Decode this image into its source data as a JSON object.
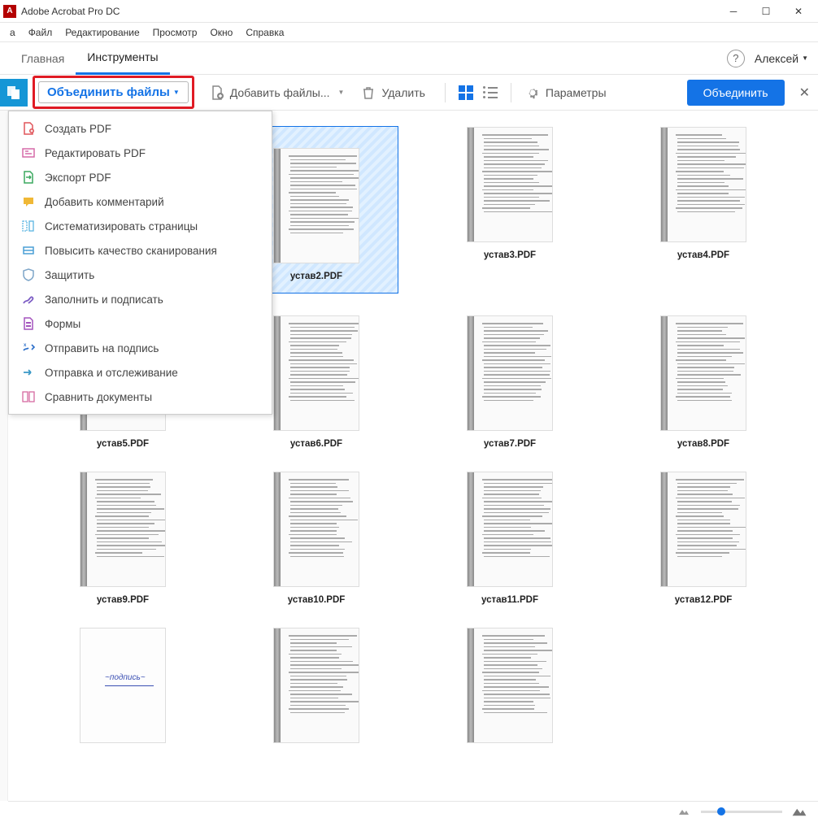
{
  "titlebar": {
    "title": "Adobe Acrobat Pro DC"
  },
  "menubar": {
    "items": [
      "а",
      "Файл",
      "Редактирование",
      "Просмотр",
      "Окно",
      "Справка"
    ]
  },
  "tabs": {
    "items": [
      "Главная",
      "Инструменты"
    ],
    "active_index": 1,
    "user": "Алексей"
  },
  "toolbar": {
    "combine_label": "Объединить файлы",
    "add_label": "Добавить файлы...",
    "delete_label": "Удалить",
    "params_label": "Параметры",
    "action_label": "Объединить"
  },
  "dropdown": {
    "items": [
      {
        "label": "Создать PDF",
        "icon": "create-pdf",
        "color": "#e0555a"
      },
      {
        "label": "Редактировать PDF",
        "icon": "edit-pdf",
        "color": "#d66aa8"
      },
      {
        "label": "Экспорт PDF",
        "icon": "export-pdf",
        "color": "#3aa85f"
      },
      {
        "label": "Добавить комментарий",
        "icon": "comment",
        "color": "#f0b836"
      },
      {
        "label": "Систематизировать страницы",
        "icon": "organize",
        "color": "#5ab5e2"
      },
      {
        "label": "Повысить качество сканирования",
        "icon": "enhance-scan",
        "color": "#4a9fd6"
      },
      {
        "label": "Защитить",
        "icon": "shield",
        "color": "#7fa6c9"
      },
      {
        "label": "Заполнить и подписать",
        "icon": "fill-sign",
        "color": "#7c5cc4"
      },
      {
        "label": "Формы",
        "icon": "forms",
        "color": "#a454bd"
      },
      {
        "label": "Отправить на подпись",
        "icon": "send-sign",
        "color": "#2b6ec9"
      },
      {
        "label": "Отправка и отслеживание",
        "icon": "send-track",
        "color": "#3998c6"
      },
      {
        "label": "Сравнить документы",
        "icon": "compare",
        "color": "#d66aa0"
      }
    ]
  },
  "files": [
    {
      "name": "устав2.PDF",
      "selected": true
    },
    {
      "name": "устав3.PDF",
      "selected": false
    },
    {
      "name": "устав4.PDF",
      "selected": false
    },
    {
      "name": "устав5.PDF",
      "selected": false
    },
    {
      "name": "устав6.PDF",
      "selected": false
    },
    {
      "name": "устав7.PDF",
      "selected": false
    },
    {
      "name": "устав8.PDF",
      "selected": false
    },
    {
      "name": "устав9.PDF",
      "selected": false
    },
    {
      "name": "устав10.PDF",
      "selected": false
    },
    {
      "name": "устав11.PDF",
      "selected": false
    },
    {
      "name": "устав12.PDF",
      "selected": false
    },
    {
      "name": "",
      "selected": false,
      "sign": true
    },
    {
      "name": "",
      "selected": false
    },
    {
      "name": "",
      "selected": false
    }
  ]
}
